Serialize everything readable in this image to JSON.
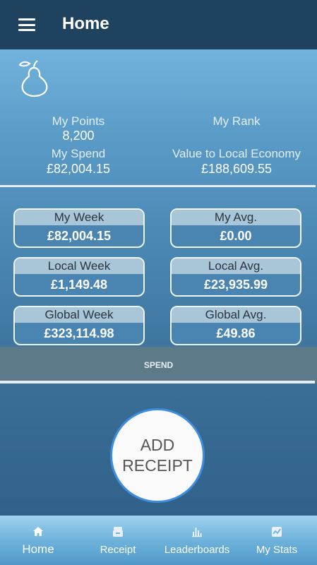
{
  "appbar": {
    "title": "Home"
  },
  "stats": {
    "points_label": "My Points",
    "points_value": "8,200",
    "rank_label": "My Rank",
    "spend_label": "My Spend",
    "spend_value": "£82,004.15",
    "economy_label": "Value to Local Economy",
    "economy_value": "£188,609.55"
  },
  "cards": [
    {
      "label": "My Week",
      "value": "£82,004.15"
    },
    {
      "label": "My Avg.",
      "value": "£0.00"
    },
    {
      "label": "Local Week",
      "value": "£1,149.48"
    },
    {
      "label": "Local Avg.",
      "value": "£23,935.99"
    },
    {
      "label": "Global Week",
      "value": "£323,114.98"
    },
    {
      "label": "Global Avg.",
      "value": "£49.86"
    }
  ],
  "tab": {
    "spend_label": "SPEND"
  },
  "add_receipt": {
    "line1": "ADD",
    "line2": "RECEIPT"
  },
  "nav": [
    {
      "label": "Home",
      "icon": "home-icon",
      "active": true
    },
    {
      "label": "Receipt",
      "icon": "receipt-icon",
      "active": false
    },
    {
      "label": "Leaderboards",
      "icon": "leaderboard-icon",
      "active": false
    },
    {
      "label": "My Stats",
      "icon": "chart-icon",
      "active": false
    }
  ],
  "colors": {
    "appbar": "#1f435e",
    "accent_ring": "#3d8ee0",
    "card_header": "#a9c5d8"
  }
}
